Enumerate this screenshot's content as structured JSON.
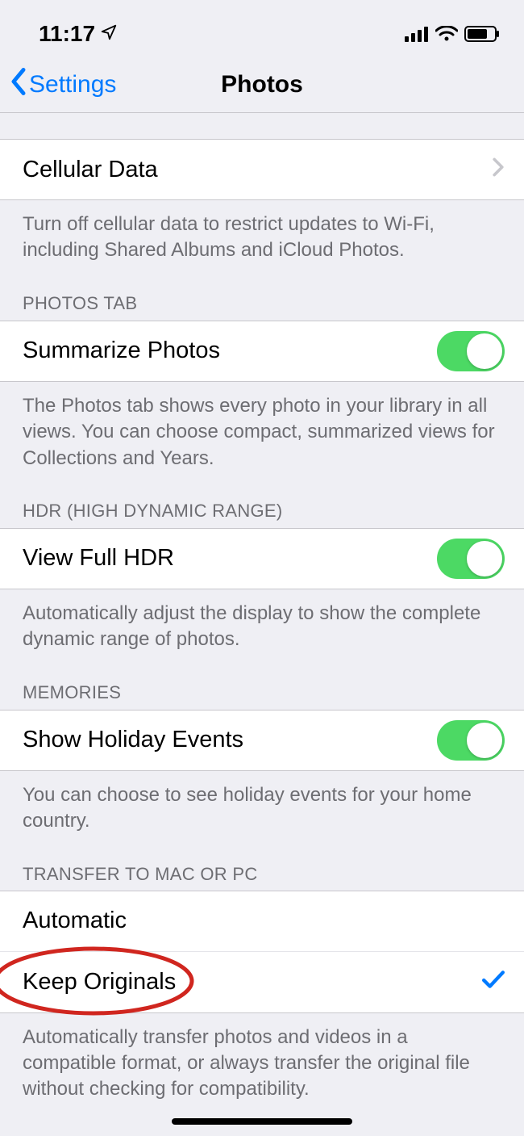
{
  "status": {
    "time": "11:17"
  },
  "nav": {
    "back": "Settings",
    "title": "Photos"
  },
  "cellular": {
    "label": "Cellular Data",
    "footer": "Turn off cellular data to restrict updates to Wi-Fi, including Shared Albums and iCloud Photos."
  },
  "photosTab": {
    "header": "PHOTOS TAB",
    "label": "Summarize Photos",
    "footer": "The Photos tab shows every photo in your library in all views. You can choose compact, summarized views for Collections and Years."
  },
  "hdr": {
    "header": "HDR (HIGH DYNAMIC RANGE)",
    "label": "View Full HDR",
    "footer": "Automatically adjust the display to show the complete dynamic range of photos."
  },
  "memories": {
    "header": "MEMORIES",
    "label": "Show Holiday Events",
    "footer": "You can choose to see holiday events for your home country."
  },
  "transfer": {
    "header": "TRANSFER TO MAC OR PC",
    "opt1": "Automatic",
    "opt2": "Keep Originals",
    "footer": "Automatically transfer photos and videos in a compatible format, or always transfer the original file without checking for compatibility."
  }
}
